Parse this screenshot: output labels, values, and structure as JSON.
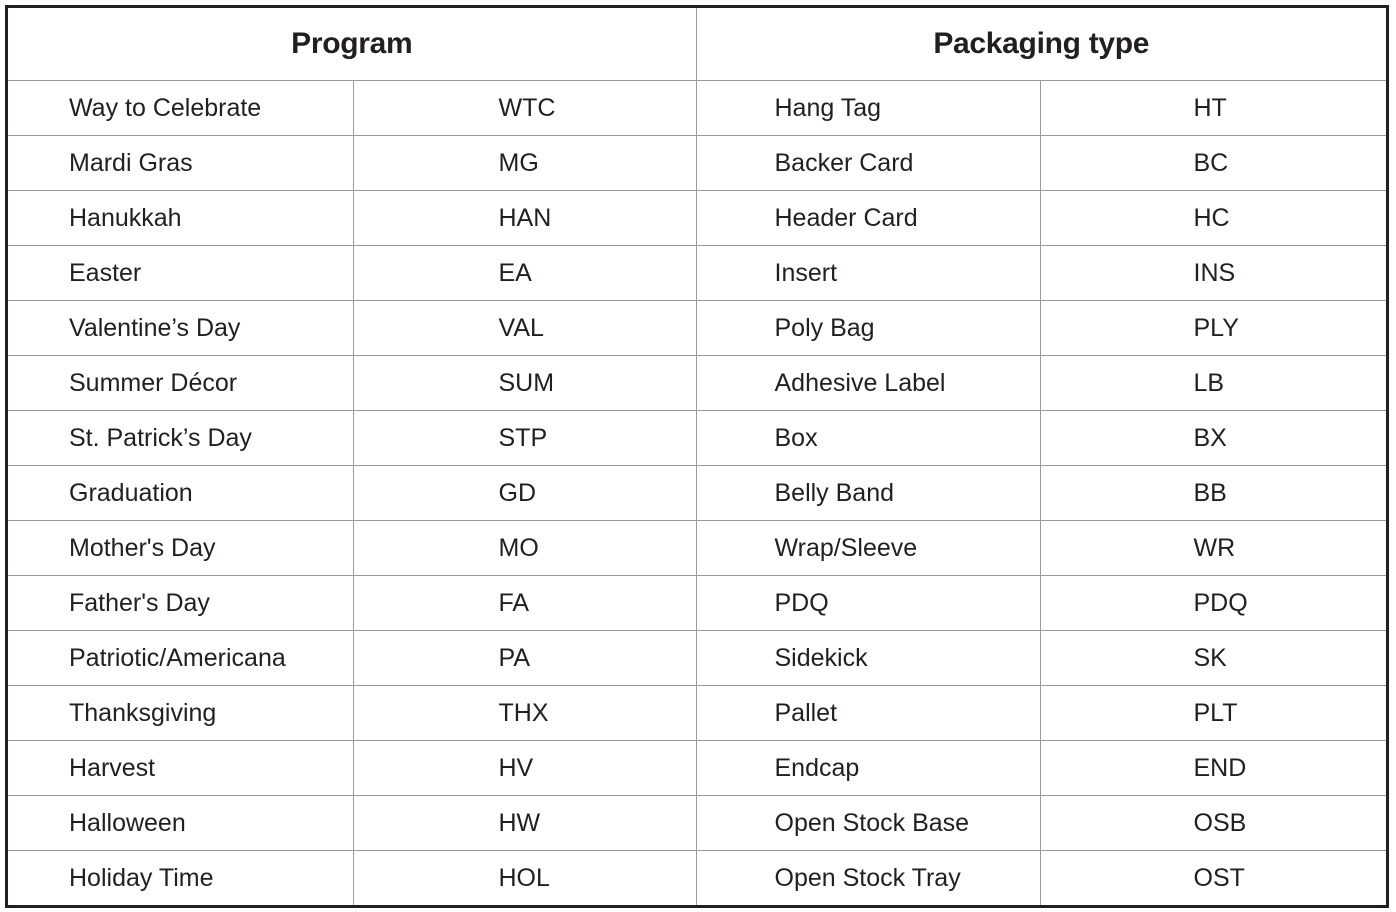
{
  "headers": {
    "program": "Program",
    "packaging": "Packaging type"
  },
  "rows": [
    {
      "program": "Way to Celebrate",
      "program_code": "WTC",
      "packaging": "Hang Tag",
      "packaging_code": "HT"
    },
    {
      "program": "Mardi Gras",
      "program_code": "MG",
      "packaging": "Backer Card",
      "packaging_code": "BC"
    },
    {
      "program": "Hanukkah",
      "program_code": "HAN",
      "packaging": "Header Card",
      "packaging_code": "HC"
    },
    {
      "program": "Easter",
      "program_code": "EA",
      "packaging": "Insert",
      "packaging_code": "INS"
    },
    {
      "program": "Valentine’s Day",
      "program_code": "VAL",
      "packaging": "Poly Bag",
      "packaging_code": "PLY"
    },
    {
      "program": "Summer Décor",
      "program_code": "SUM",
      "packaging": "Adhesive Label",
      "packaging_code": "LB"
    },
    {
      "program": "St. Patrick’s Day",
      "program_code": "STP",
      "packaging": "Box",
      "packaging_code": "BX"
    },
    {
      "program": "Graduation",
      "program_code": "GD",
      "packaging": "Belly Band",
      "packaging_code": "BB"
    },
    {
      "program": "Mother's Day",
      "program_code": "MO",
      "packaging": "Wrap/Sleeve",
      "packaging_code": "WR"
    },
    {
      "program": "Father's Day",
      "program_code": "FA",
      "packaging": "PDQ",
      "packaging_code": "PDQ"
    },
    {
      "program": "Patriotic/Americana",
      "program_code": "PA",
      "packaging": "Sidekick",
      "packaging_code": "SK"
    },
    {
      "program": "Thanksgiving",
      "program_code": "THX",
      "packaging": "Pallet",
      "packaging_code": "PLT"
    },
    {
      "program": "Harvest",
      "program_code": "HV",
      "packaging": "Endcap",
      "packaging_code": "END"
    },
    {
      "program": "Halloween",
      "program_code": "HW",
      "packaging": "Open Stock Base",
      "packaging_code": "OSB"
    },
    {
      "program": "Holiday Time",
      "program_code": "HOL",
      "packaging": "Open Stock Tray",
      "packaging_code": "OST"
    }
  ]
}
